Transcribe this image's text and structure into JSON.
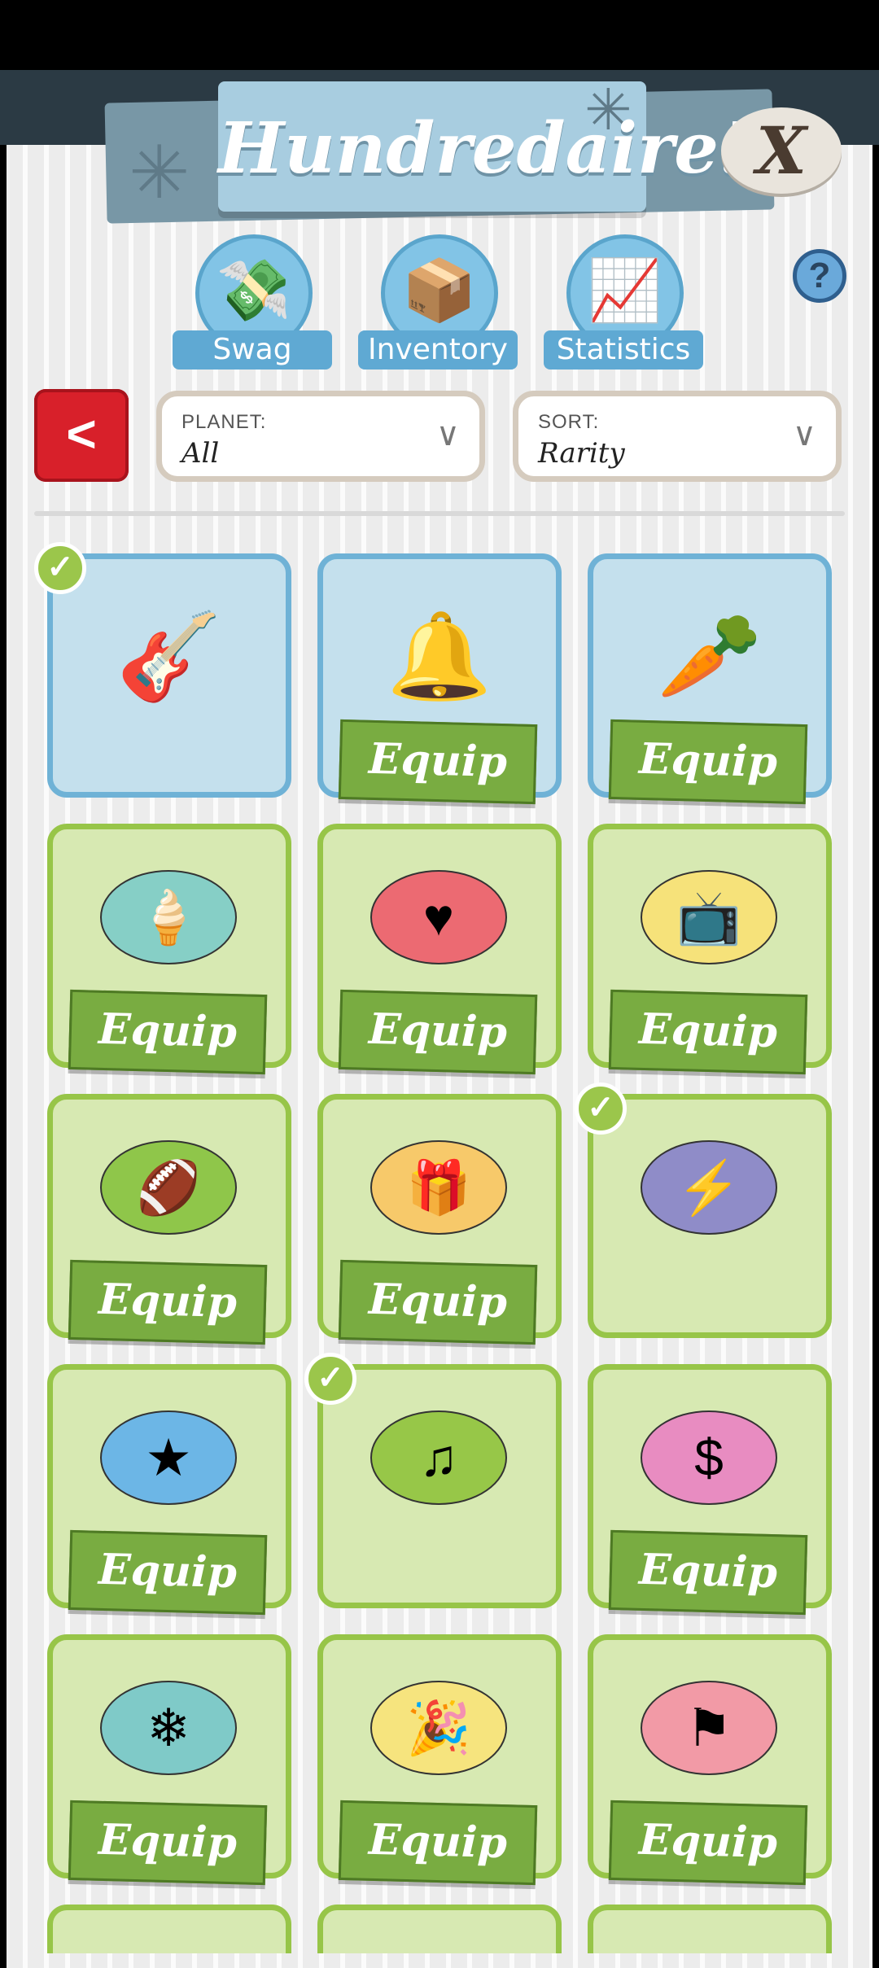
{
  "header": {
    "title": "Hundredaire!",
    "close_label": "X",
    "sparkle_icon": "sparkle-icon"
  },
  "tabs": [
    {
      "label": "Swag",
      "icon": "cash-machine-icon",
      "glyph": "💸"
    },
    {
      "label": "Inventory",
      "icon": "money-box-icon",
      "glyph": "📦"
    },
    {
      "label": "Statistics",
      "icon": "chart-arrows-icon",
      "glyph": "📈"
    }
  ],
  "help_label": "?",
  "back_label": "<",
  "filters": {
    "planet": {
      "caption": "PLANET:",
      "value": "All"
    },
    "sort": {
      "caption": "SORT:",
      "value": "Rarity"
    }
  },
  "equip_label": "Equip",
  "items": [
    {
      "name": "amp",
      "glyph": "🎸",
      "style": "item",
      "bg": "",
      "equipped": true,
      "rarity": "blue"
    },
    {
      "name": "bells",
      "glyph": "🔔",
      "style": "item",
      "bg": "",
      "equipped": false,
      "rarity": "blue"
    },
    {
      "name": "carrot",
      "glyph": "🥕",
      "style": "item",
      "bg": "",
      "equipped": false,
      "rarity": "blue"
    },
    {
      "name": "popsicle",
      "glyph": "🍦",
      "style": "badge",
      "bg": "#86cfc6",
      "equipped": false,
      "rarity": "green"
    },
    {
      "name": "heart",
      "glyph": "♥",
      "style": "badge",
      "bg": "#ec6a72",
      "equipped": false,
      "rarity": "green"
    },
    {
      "name": "tv",
      "glyph": "📺",
      "style": "badge",
      "bg": "#f6e27a",
      "equipped": false,
      "rarity": "green"
    },
    {
      "name": "football",
      "glyph": "🏈",
      "style": "badge",
      "bg": "#8fc64a",
      "equipped": false,
      "rarity": "green"
    },
    {
      "name": "gift",
      "glyph": "🎁",
      "style": "badge",
      "bg": "#f7c96a",
      "equipped": false,
      "rarity": "green"
    },
    {
      "name": "lightning",
      "glyph": "⚡",
      "style": "badge",
      "bg": "#8f8cc8",
      "equipped": true,
      "rarity": "green"
    },
    {
      "name": "medal",
      "glyph": "★",
      "style": "badge",
      "bg": "#6cb6e6",
      "equipped": false,
      "rarity": "green"
    },
    {
      "name": "music",
      "glyph": "♫",
      "style": "badge",
      "bg": "#97c748",
      "equipped": true,
      "rarity": "green"
    },
    {
      "name": "dollar",
      "glyph": "$",
      "style": "badge",
      "bg": "#e88cc1",
      "equipped": false,
      "rarity": "green"
    },
    {
      "name": "snowflake",
      "glyph": "❄",
      "style": "badge",
      "bg": "#7fcac8",
      "equipped": false,
      "rarity": "green"
    },
    {
      "name": "party-hat",
      "glyph": "🎉",
      "style": "badge",
      "bg": "#f6e47e",
      "equipped": false,
      "rarity": "green"
    },
    {
      "name": "flag",
      "glyph": "⚑",
      "style": "badge",
      "bg": "#f29aa6",
      "equipped": false,
      "rarity": "green"
    }
  ],
  "check_glyph": "✓"
}
